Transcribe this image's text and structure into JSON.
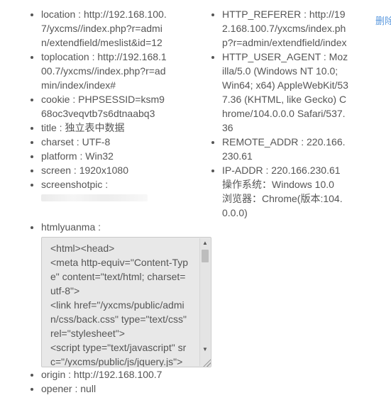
{
  "left": {
    "location": {
      "label": "location :",
      "lines": [
        "http://192.168.100.",
        "7/yxcms//index.php?r=admi",
        "n/extendfield/meslist&id=12"
      ]
    },
    "toplocation": {
      "label": "toplocation :",
      "lines": [
        "http://192.168.1",
        "00.7/yxcms//index.php?r=ad",
        "min/index/index#"
      ]
    },
    "cookie": {
      "label": "cookie :",
      "lines": [
        "PHPSESSID=ksm9",
        "68oc3veqvtb7s6dtnaabq3"
      ]
    },
    "title": {
      "label": "title :",
      "value": "独立表中数据"
    },
    "charset": {
      "label": "charset :",
      "value": "UTF-8"
    },
    "platform": {
      "label": "platform :",
      "value": "Win32"
    },
    "screen": {
      "label": "screen :",
      "value": "1920x1080"
    },
    "screenshotpic": {
      "label": "screenshotpic :"
    },
    "htmlyuanma": {
      "label": "htmlyuanma :",
      "source_lines": [
        "<html><head>",
        "<meta http-equiv=\"Content-Typ",
        "e\" content=\"text/html; charset=",
        "utf-8\">",
        "<link href=\"/yxcms/public/admi",
        "n/css/back.css\" type=\"text/css\"",
        "rel=\"stylesheet\">",
        "<script type=\"text/javascript\" sr",
        "c=\"/yxcms/public/js/jquery.js\">"
      ]
    },
    "origin": {
      "label": "origin :",
      "value": "http://192.168.100.7"
    },
    "opener": {
      "label": "opener :",
      "value": "null"
    }
  },
  "right": {
    "http_referer": {
      "label": "HTTP_REFERER :",
      "lines": [
        "http://19",
        "2.168.100.7/yxcms/index.ph",
        "p?r=admin/extendfield/index"
      ]
    },
    "http_user_agent": {
      "label": "HTTP_USER_AGENT :",
      "lines": [
        "Moz",
        "illa/5.0 (Windows NT 10.0;",
        "Win64; x64) AppleWebKit/53",
        "7.36 (KHTML, like Gecko) C",
        "hrome/104.0.0.0 Safari/537.",
        "36"
      ]
    },
    "remote_addr": {
      "label": "REMOTE_ADDR :",
      "lines": [
        "220.166.",
        "230.61"
      ]
    },
    "ip_addr": {
      "label": "IP-ADDR :",
      "lines": [
        "220.166.230.61",
        "操作系统：Windows 10.0",
        "浏览器：Chrome(版本:104.",
        "0.0.0)"
      ]
    }
  },
  "actions": {
    "delete_label": "删除"
  },
  "icons": {
    "scroll_up": "triangle-up",
    "scroll_down": "triangle-down",
    "resize": "resize-grip"
  }
}
